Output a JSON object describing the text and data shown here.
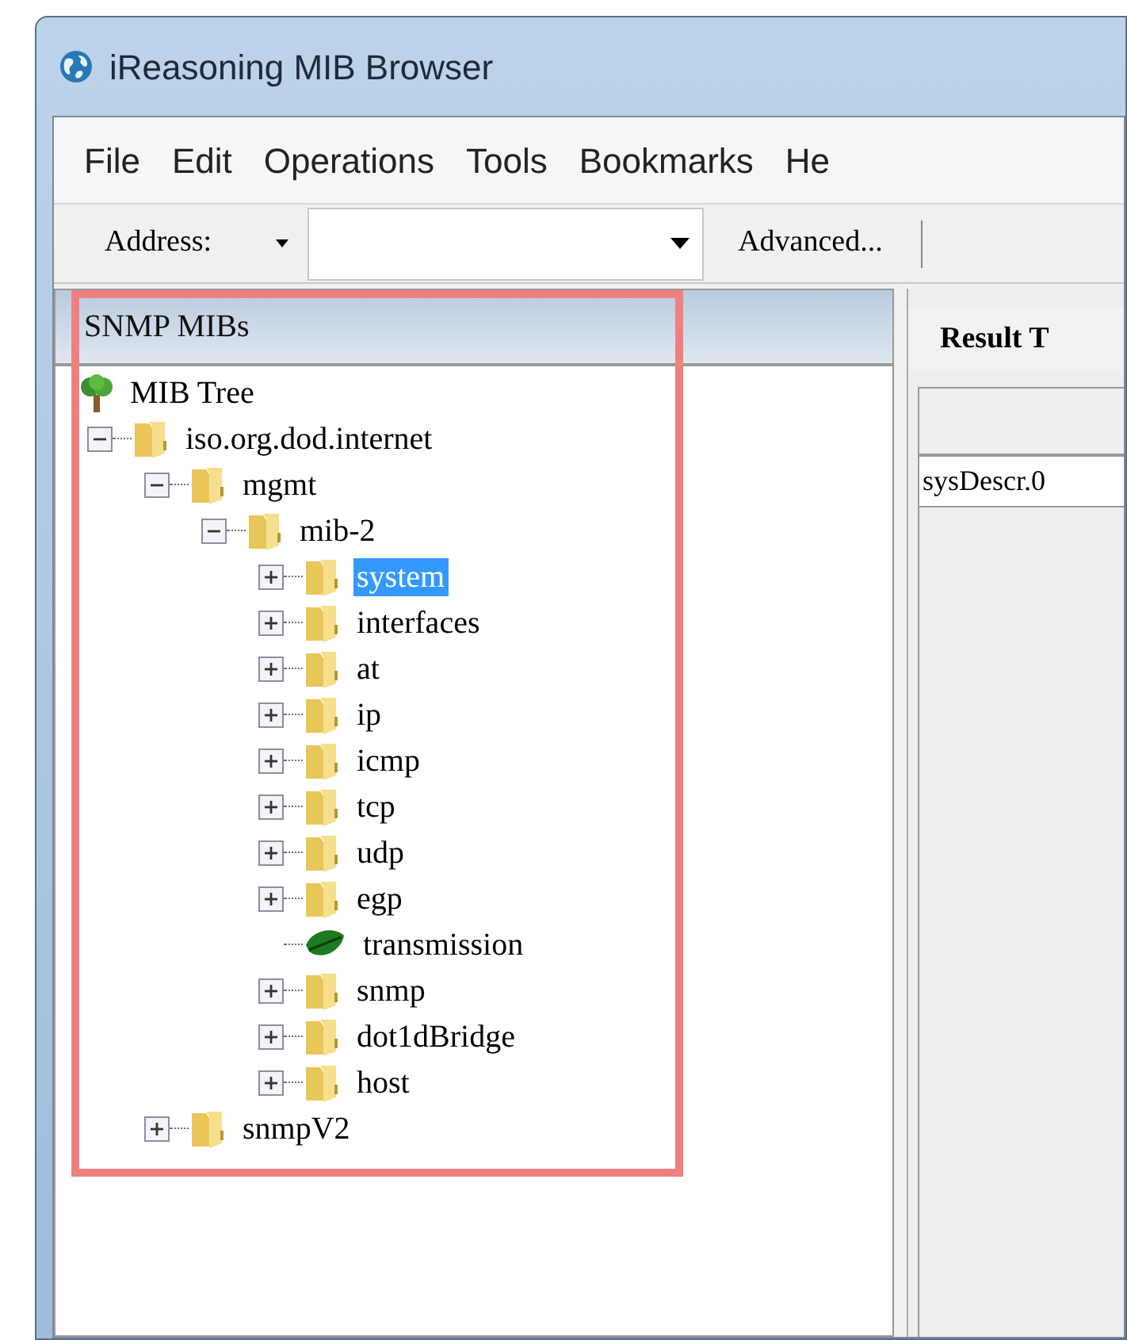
{
  "window": {
    "title": "iReasoning MIB Browser"
  },
  "menu": [
    "File",
    "Edit",
    "Operations",
    "Tools",
    "Bookmarks",
    "He"
  ],
  "toolbar": {
    "address_label": "Address:",
    "advanced_button": "Advanced..."
  },
  "mib_panel": {
    "title": "SNMP MIBs",
    "tree": [
      {
        "label": "MIB Tree",
        "kind": "root",
        "selected": false,
        "children": [
          {
            "label": "iso.org.dod.internet",
            "kind": "folder",
            "expanded": true,
            "selected": false,
            "children": [
              {
                "label": "mgmt",
                "kind": "folder",
                "expanded": true,
                "selected": false,
                "children": [
                  {
                    "label": "mib-2",
                    "kind": "folder",
                    "expanded": true,
                    "selected": false,
                    "children": [
                      {
                        "label": "system",
                        "kind": "folder",
                        "expanded": false,
                        "selected": true
                      },
                      {
                        "label": "interfaces",
                        "kind": "folder",
                        "expanded": false,
                        "selected": false
                      },
                      {
                        "label": "at",
                        "kind": "folder",
                        "expanded": false,
                        "selected": false
                      },
                      {
                        "label": "ip",
                        "kind": "folder",
                        "expanded": false,
                        "selected": false
                      },
                      {
                        "label": "icmp",
                        "kind": "folder",
                        "expanded": false,
                        "selected": false
                      },
                      {
                        "label": "tcp",
                        "kind": "folder",
                        "expanded": false,
                        "selected": false
                      },
                      {
                        "label": "udp",
                        "kind": "folder",
                        "expanded": false,
                        "selected": false
                      },
                      {
                        "label": "egp",
                        "kind": "folder",
                        "expanded": false,
                        "selected": false
                      },
                      {
                        "label": "transmission",
                        "kind": "leaf",
                        "selected": false
                      },
                      {
                        "label": "snmp",
                        "kind": "folder",
                        "expanded": false,
                        "selected": false
                      },
                      {
                        "label": "dot1dBridge",
                        "kind": "folder",
                        "expanded": false,
                        "selected": false
                      },
                      {
                        "label": "host",
                        "kind": "folder",
                        "expanded": false,
                        "selected": false
                      }
                    ]
                  }
                ]
              },
              {
                "label": "snmpV2",
                "kind": "folder",
                "expanded": false,
                "selected": false
              }
            ]
          }
        ]
      }
    ]
  },
  "result_panel": {
    "tab": "Result T",
    "rows": [
      [
        "sysDescr.0"
      ]
    ]
  }
}
